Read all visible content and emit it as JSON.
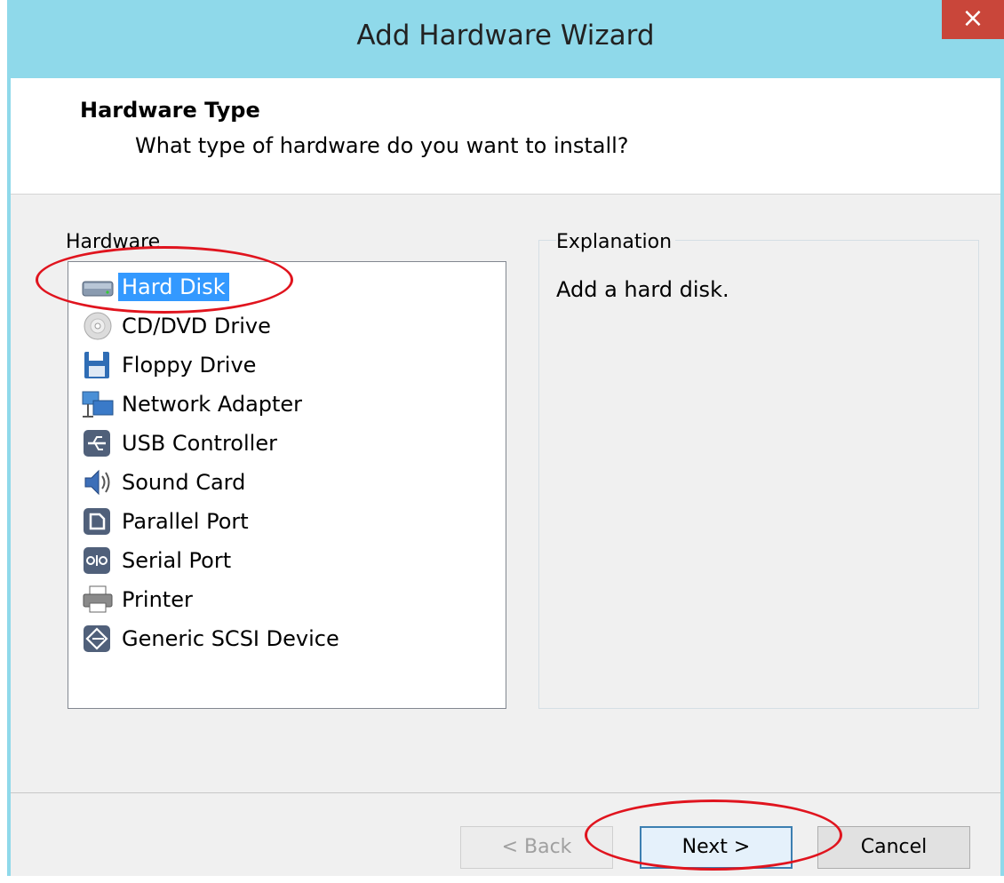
{
  "window": {
    "title": "Add Hardware Wizard",
    "close_glyph": "×"
  },
  "header": {
    "title": "Hardware Type",
    "subtitle": "What type of hardware do you want to install?"
  },
  "hardware_group": {
    "label": "Hardware",
    "selected_index": 0,
    "items": [
      {
        "label": "Hard Disk",
        "icon": "hard-disk-icon"
      },
      {
        "label": "CD/DVD Drive",
        "icon": "cd-dvd-icon"
      },
      {
        "label": "Floppy Drive",
        "icon": "floppy-icon"
      },
      {
        "label": "Network Adapter",
        "icon": "network-adapter-icon"
      },
      {
        "label": "USB Controller",
        "icon": "usb-icon"
      },
      {
        "label": "Sound Card",
        "icon": "sound-card-icon"
      },
      {
        "label": "Parallel Port",
        "icon": "parallel-port-icon"
      },
      {
        "label": "Serial Port",
        "icon": "serial-port-icon"
      },
      {
        "label": "Printer",
        "icon": "printer-icon"
      },
      {
        "label": "Generic SCSI Device",
        "icon": "scsi-icon"
      }
    ]
  },
  "explanation_group": {
    "label": "Explanation",
    "text": "Add a hard disk."
  },
  "buttons": {
    "back": "< Back",
    "next": "Next >",
    "cancel": "Cancel"
  },
  "colors": {
    "title_bar": "#8fd9ea",
    "selection": "#3399ff",
    "annotation": "#e0141e"
  }
}
